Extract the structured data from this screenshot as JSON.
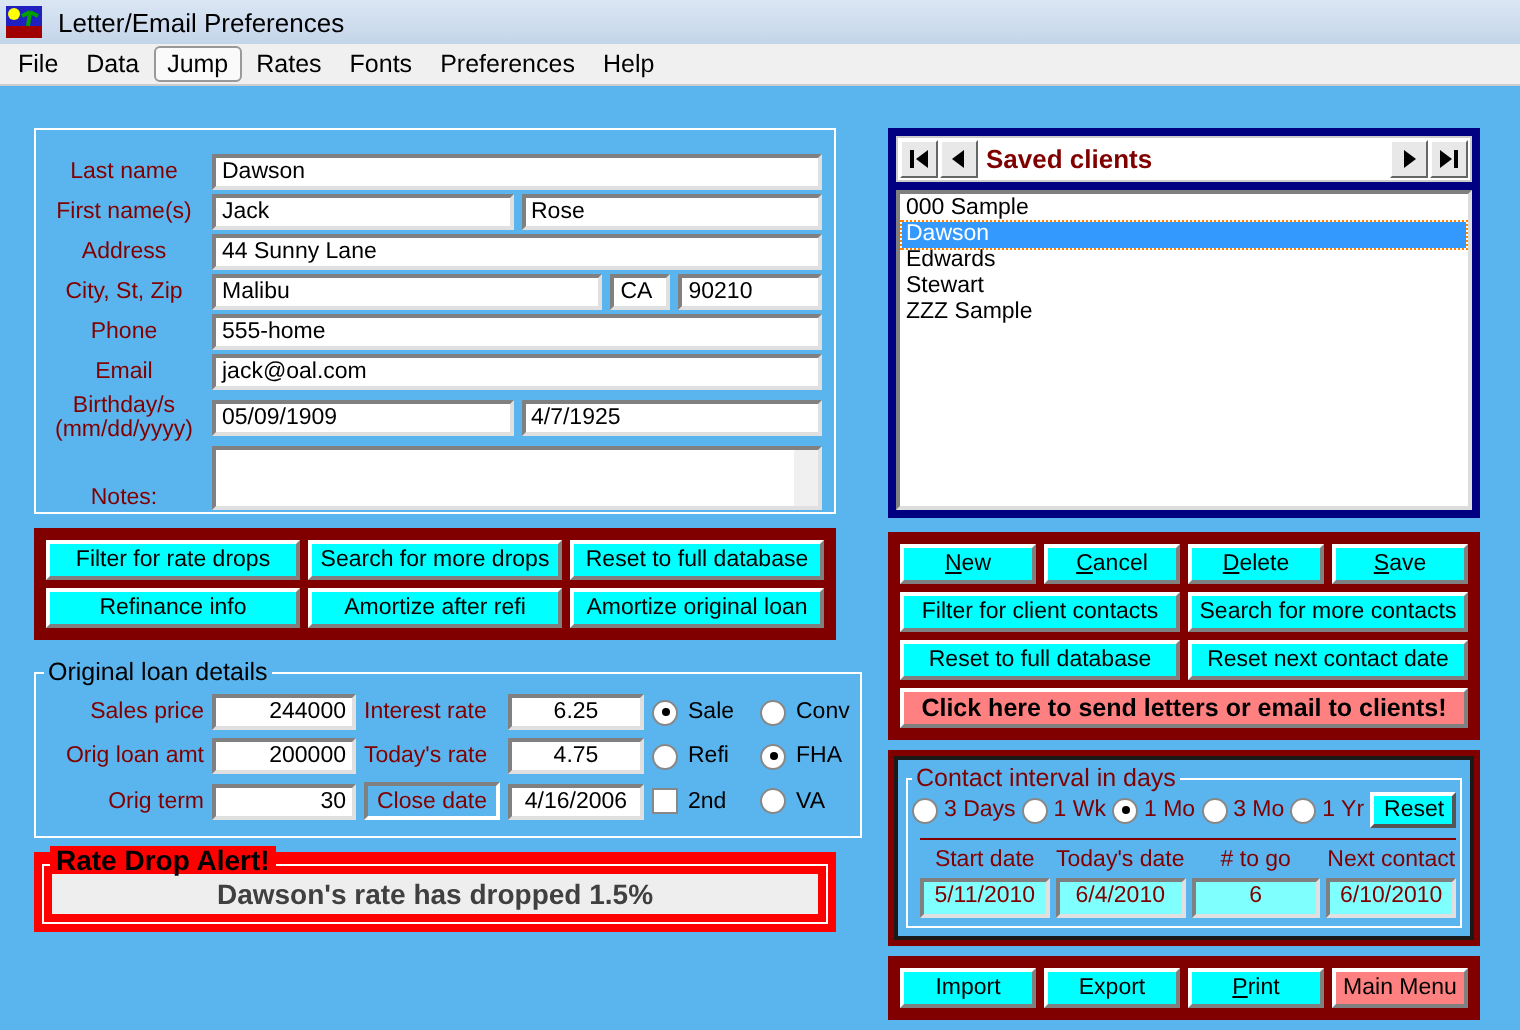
{
  "window": {
    "title": "Letter/Email Preferences"
  },
  "menu": [
    {
      "label": "File",
      "selected": false
    },
    {
      "label": "Data",
      "selected": false
    },
    {
      "label": "Jump",
      "selected": true
    },
    {
      "label": "Rates",
      "selected": false
    },
    {
      "label": "Fonts",
      "selected": false
    },
    {
      "label": "Preferences",
      "selected": false
    },
    {
      "label": "Help",
      "selected": false
    }
  ],
  "contact_form": {
    "rows": [
      {
        "label": "Last name",
        "values": [
          "Dawson"
        ]
      },
      {
        "label": "First name(s)",
        "values": [
          "Jack",
          "Rose"
        ]
      },
      {
        "label": "Address",
        "values": [
          "44 Sunny Lane"
        ]
      },
      {
        "label": "City, St, Zip",
        "values": [
          "Malibu",
          "CA",
          "90210"
        ]
      },
      {
        "label": "Phone",
        "values": [
          "555-home"
        ]
      },
      {
        "label": "Email",
        "values": [
          "jack@oal.com"
        ]
      },
      {
        "label": "Birthday/s (mm/dd/yyyy)",
        "values": [
          "05/09/1909",
          "4/7/1925"
        ]
      }
    ],
    "notes_label": "Notes:"
  },
  "rate_buttons": [
    "Filter for rate drops",
    "Search for more drops",
    "Reset to full database",
    "Refinance info",
    "Amortize after refi",
    "Amortize original loan"
  ],
  "loan_details": {
    "title": "Original loan details",
    "fields": [
      {
        "label": "Sales price",
        "value": "244000"
      },
      {
        "label": "Interest rate",
        "value": "6.25"
      },
      {
        "label": "Orig loan amt",
        "value": "200000"
      },
      {
        "label": "Today's rate",
        "value": "4.75"
      },
      {
        "label": "Orig term",
        "value": "30"
      },
      {
        "label": "Close date",
        "value": "4/16/2006",
        "kind": "button"
      }
    ],
    "purpose": [
      {
        "label": "Sale",
        "selected": true
      },
      {
        "label": "Refi",
        "selected": false
      }
    ],
    "second": {
      "label": "2nd",
      "checked": false
    },
    "loan_type": [
      {
        "label": "Conv",
        "selected": false
      },
      {
        "label": "FHA",
        "selected": true
      },
      {
        "label": "VA",
        "selected": false
      }
    ]
  },
  "alert": {
    "title": "Rate Drop Alert!",
    "message": "Dawson's rate has dropped 1.5%"
  },
  "clients": {
    "title": "Saved clients",
    "items": [
      {
        "label": "000 Sample",
        "selected": false
      },
      {
        "label": "Dawson",
        "selected": true
      },
      {
        "label": "Edwards",
        "selected": false
      },
      {
        "label": "Stewart",
        "selected": false
      },
      {
        "label": "ZZZ Sample",
        "selected": false
      }
    ]
  },
  "client_buttons": [
    {
      "label": "New",
      "mnemonic": true
    },
    {
      "label": "Cancel",
      "mnemonic": true
    },
    {
      "label": "Delete",
      "mnemonic": true
    },
    {
      "label": "Save",
      "mnemonic": true
    }
  ],
  "contact_buttons": [
    "Filter for client contacts",
    "Search for more contacts",
    "Reset to full database",
    "Reset next contact date"
  ],
  "send_button": "Click here to send letters or email to clients!",
  "contact_interval": {
    "title": "Contact interval in days",
    "options": [
      {
        "label": "3 Days",
        "selected": false
      },
      {
        "label": "1 Wk",
        "selected": false
      },
      {
        "label": "1 Mo",
        "selected": true
      },
      {
        "label": "3 Mo",
        "selected": false
      },
      {
        "label": "1 Yr",
        "selected": false
      }
    ],
    "reset": "Reset",
    "columns": [
      {
        "label": "Start date",
        "value": "5/11/2010"
      },
      {
        "label": "Today's date",
        "value": "6/4/2010"
      },
      {
        "label": "# to go",
        "value": "6"
      },
      {
        "label": "Next contact",
        "value": "6/10/2010"
      }
    ]
  },
  "bottom_buttons": [
    {
      "label": "Import",
      "kind": "normal",
      "mnemonic": false
    },
    {
      "label": "Export",
      "kind": "normal",
      "mnemonic": false
    },
    {
      "label": "Print",
      "kind": "normal",
      "mnemonic": true
    },
    {
      "label": "Main Menu",
      "kind": "accent",
      "mnemonic": false
    }
  ]
}
